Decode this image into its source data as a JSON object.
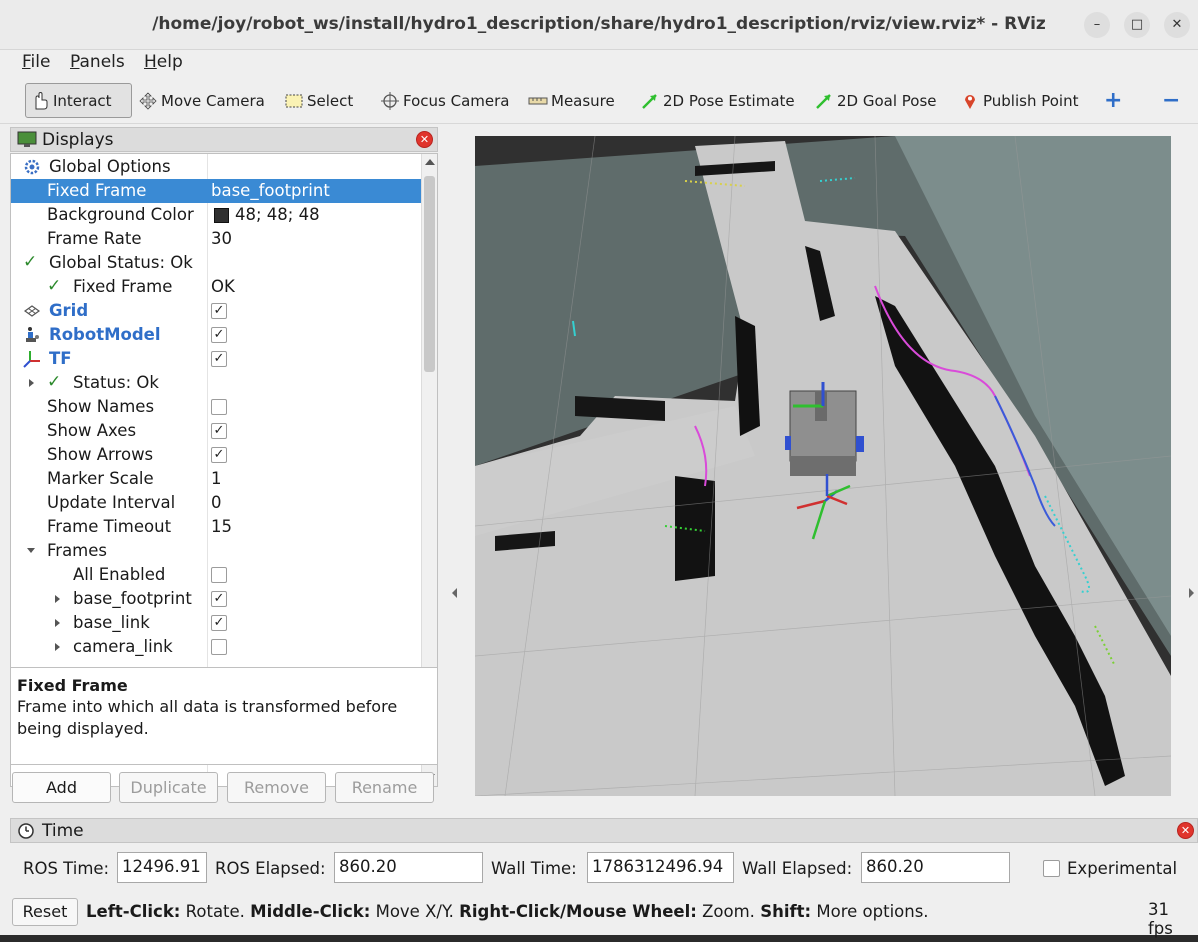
{
  "window": {
    "title": "/home/joy/robot_ws/install/hydro1_description/share/hydro1_description/rviz/view.rviz* - RViz",
    "minimize": "–",
    "maximize": "□",
    "close": "✕"
  },
  "menu": {
    "file": "File",
    "panels": "Panels",
    "help": "Help"
  },
  "toolbar": {
    "interact": "Interact",
    "move_camera": "Move Camera",
    "select": "Select",
    "focus_camera": "Focus Camera",
    "measure": "Measure",
    "pose_estimate": "2D Pose Estimate",
    "goal_pose": "2D Goal Pose",
    "publish_point": "Publish Point",
    "add": "+",
    "remove": "−"
  },
  "displays": {
    "title": "Displays",
    "global_options": "Global Options",
    "fixed_frame_label": "Fixed Frame",
    "fixed_frame_value": "base_footprint",
    "background_color_label": "Background Color",
    "background_color_value": "48; 48; 48",
    "frame_rate_label": "Frame Rate",
    "frame_rate_value": "30",
    "global_status": "Global Status: Ok",
    "status_fixed_frame_label": "Fixed Frame",
    "status_fixed_frame_value": "OK",
    "grid": "Grid",
    "robot_model": "RobotModel",
    "tf": "TF",
    "tf_status": "Status: Ok",
    "show_names": "Show Names",
    "show_axes": "Show Axes",
    "show_arrows": "Show Arrows",
    "marker_scale_label": "Marker Scale",
    "marker_scale_value": "1",
    "update_interval_label": "Update Interval",
    "update_interval_value": "0",
    "frame_timeout_label": "Frame Timeout",
    "frame_timeout_value": "15",
    "frames": "Frames",
    "all_enabled": "All Enabled",
    "frame_base_footprint": "base_footprint",
    "frame_base_link": "base_link",
    "frame_camera_link": "camera_link",
    "checked": "✓"
  },
  "description": {
    "title": "Fixed Frame",
    "body": "Frame into which all data is transformed before being displayed."
  },
  "panel_buttons": {
    "add": "Add",
    "duplicate": "Duplicate",
    "remove": "Remove",
    "rename": "Rename"
  },
  "time": {
    "title": "Time",
    "ros_time_label": "ROS Time:",
    "ros_time_value": "12496.91",
    "ros_elapsed_label": "ROS Elapsed:",
    "ros_elapsed_value": "860.20",
    "wall_time_label": "Wall Time:",
    "wall_time_value": "1786312496.94",
    "wall_elapsed_label": "Wall Elapsed:",
    "wall_elapsed_value": "860.20",
    "experimental": "Experimental"
  },
  "status_bar": {
    "reset": "Reset",
    "hint_left_b": "Left-Click:",
    "hint_left": " Rotate. ",
    "hint_mid_b": "Middle-Click:",
    "hint_mid": " Move X/Y. ",
    "hint_right_b": "Right-Click/Mouse Wheel:",
    "hint_right": " Zoom. ",
    "hint_shift_b": "Shift:",
    "hint_shift": " More options.",
    "fps": "31 fps"
  },
  "colors": {
    "background": "#303030",
    "selection": "#3a8ad4",
    "status_ok": "#2d8a2d",
    "display_name": "#2f6ec8"
  }
}
